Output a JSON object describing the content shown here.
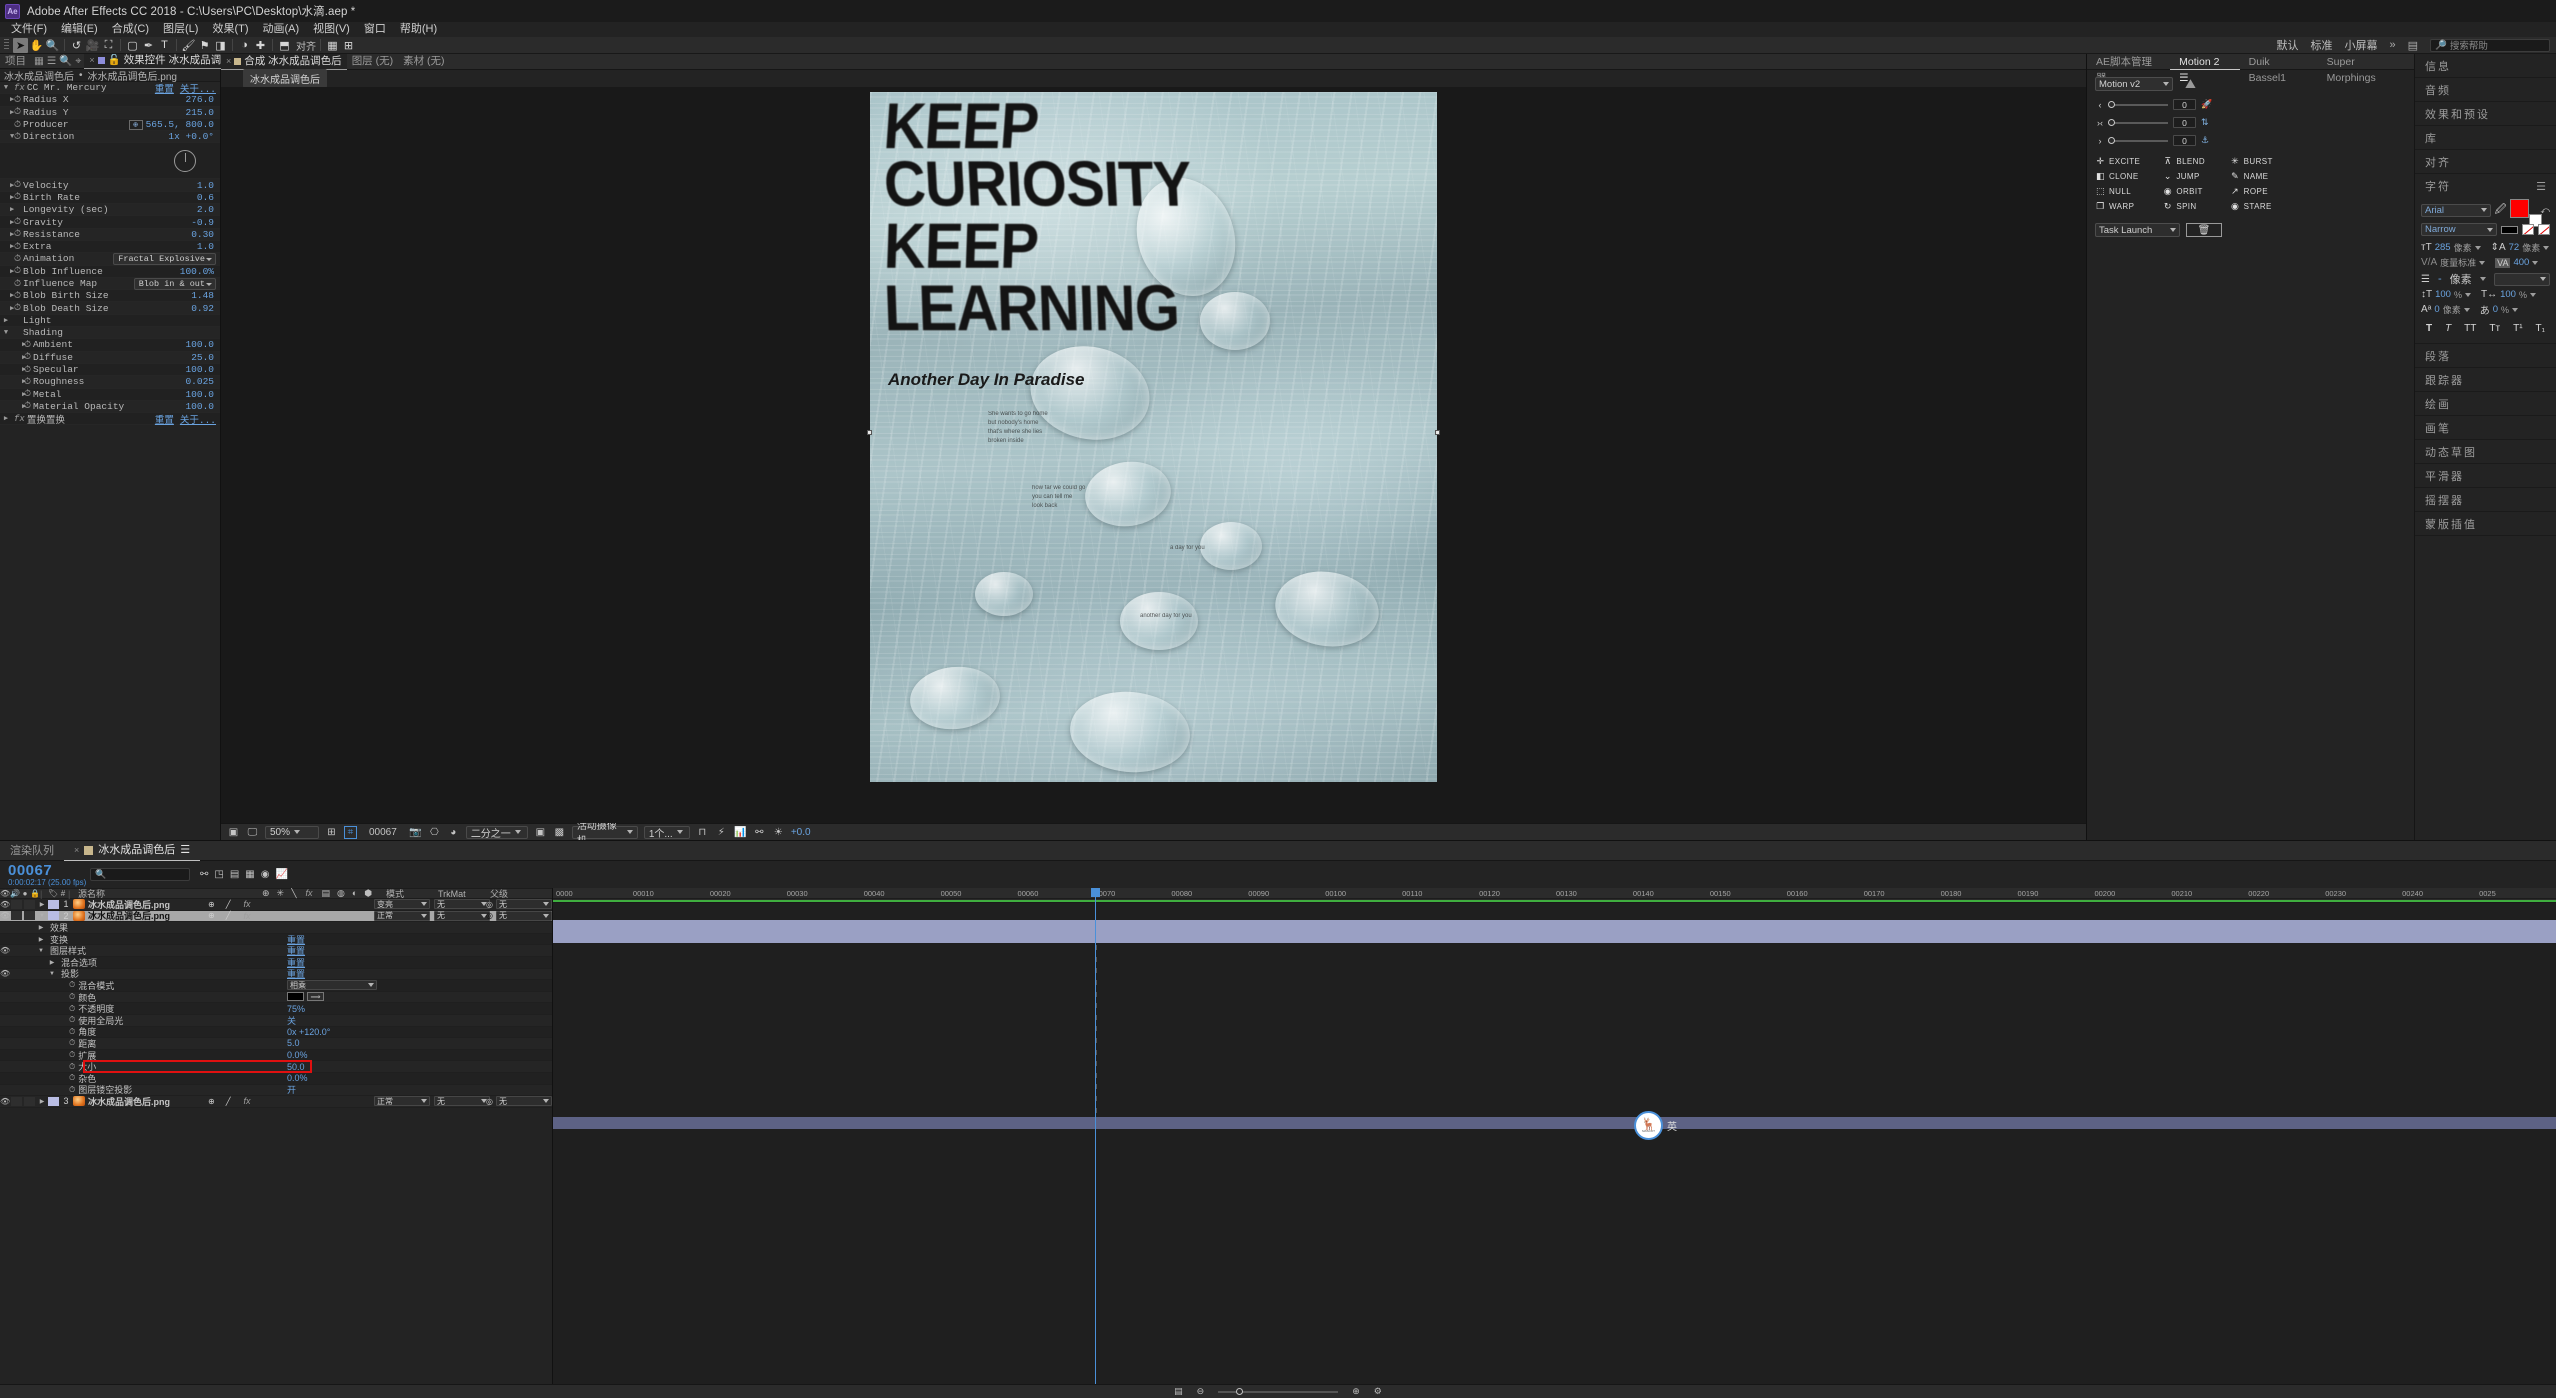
{
  "titlebar": {
    "logo": "Ae",
    "title": "Adobe After Effects CC 2018 - C:\\Users\\PC\\Desktop\\水滴.aep *"
  },
  "menubar": {
    "items": [
      "文件(F)",
      "编辑(E)",
      "合成(C)",
      "图层(L)",
      "效果(T)",
      "动画(A)",
      "视图(V)",
      "窗口",
      "帮助(H)"
    ]
  },
  "toolbar": {
    "icons": [
      "selection-tool",
      "hand-tool",
      "zoom-tool",
      "rotation-tool",
      "camera-tool",
      "anchor-point-tool",
      "mask-tool",
      "pen-tool",
      "text-tool",
      "brush-tool",
      "clone-stamp-tool",
      "eraser-tool",
      "roto-brush-tool",
      "puppet-tool"
    ],
    "workspace_left": "对齐",
    "workspaces": [
      "默认",
      "标准",
      "小屏幕"
    ],
    "search_placeholder": "搜索帮助"
  },
  "project_panel": {
    "tab_project": "项目",
    "tab_effect_controls": "效果控件 冰水成品调色后.png",
    "breadcrumb_comp": "冰水成品调色后",
    "breadcrumb_layer": "冰水成品调色后.png",
    "effect_name": "CC Mr. Mercury",
    "reset_label": "重置",
    "about_label": "关于...",
    "rows": [
      {
        "name": "Radius X",
        "value": "276.0",
        "indent": 1,
        "tw": "▶",
        "stop": true
      },
      {
        "name": "Radius Y",
        "value": "215.0",
        "indent": 1,
        "tw": "▶",
        "stop": true
      },
      {
        "name": "Producer",
        "value": "565.5, 800.0",
        "indent": 1,
        "tw": "",
        "stop": true,
        "point": true
      },
      {
        "name": "Direction",
        "value": "1x +0.0°",
        "indent": 1,
        "tw": "▼",
        "stop": true
      },
      {
        "name": "",
        "value": "",
        "indent": 1,
        "dial": true
      },
      {
        "name": "Velocity",
        "value": "1.0",
        "indent": 1,
        "tw": "▶",
        "stop": true
      },
      {
        "name": "Birth Rate",
        "value": "0.6",
        "indent": 1,
        "tw": "▶",
        "stop": true
      },
      {
        "name": "Longevity (sec)",
        "value": "2.0",
        "indent": 1,
        "tw": "▶",
        "stop": false
      },
      {
        "name": "Gravity",
        "value": "-0.9",
        "indent": 1,
        "tw": "▶",
        "stop": true
      },
      {
        "name": "Resistance",
        "value": "0.30",
        "indent": 1,
        "tw": "▶",
        "stop": true
      },
      {
        "name": "Extra",
        "value": "1.0",
        "indent": 1,
        "tw": "▶",
        "stop": true
      },
      {
        "name": "Animation",
        "value": "Fractal Explosive",
        "indent": 1,
        "tw": "",
        "stop": true,
        "select": true
      },
      {
        "name": "Blob Influence",
        "value": "100.0%",
        "indent": 1,
        "tw": "▶",
        "stop": true
      },
      {
        "name": "Influence Map",
        "value": "Blob in & out",
        "indent": 1,
        "tw": "",
        "stop": true,
        "select": true
      },
      {
        "name": "Blob Birth Size",
        "value": "1.48",
        "indent": 1,
        "tw": "▶",
        "stop": true
      },
      {
        "name": "Blob Death Size",
        "value": "0.92",
        "indent": 1,
        "tw": "▶",
        "stop": true
      },
      {
        "name": "Light",
        "value": "",
        "indent": 0,
        "tw": "▶",
        "stop": false
      },
      {
        "name": "Shading",
        "value": "",
        "indent": 0,
        "tw": "▼",
        "stop": false
      },
      {
        "name": "Ambient",
        "value": "100.0",
        "indent": 2,
        "tw": "▶",
        "stop": true
      },
      {
        "name": "Diffuse",
        "value": "25.0",
        "indent": 2,
        "tw": "▶",
        "stop": true
      },
      {
        "name": "Specular",
        "value": "100.0",
        "indent": 2,
        "tw": "▶",
        "stop": true
      },
      {
        "name": "Roughness",
        "value": "0.025",
        "indent": 2,
        "tw": "▶",
        "stop": true
      },
      {
        "name": "Metal",
        "value": "100.0",
        "indent": 2,
        "tw": "▶",
        "stop": true
      },
      {
        "name": "Material Opacity",
        "value": "100.0",
        "indent": 2,
        "tw": "▶",
        "stop": true
      }
    ],
    "second_effect": {
      "name": "置换置换",
      "reset": "重置",
      "about": "关于..."
    }
  },
  "viewer": {
    "tabs": [
      {
        "label": "合成 冰水成品调色后",
        "active": true
      },
      {
        "label": "图层 (无)",
        "active": false
      },
      {
        "label": "素材 (无)",
        "active": false
      }
    ],
    "comp_chip": "冰水成品调色后",
    "poster": {
      "lines": [
        "KEEP",
        "CURIOSITY",
        "KEEP",
        "LEARNING"
      ],
      "subtitle": "Another Day In Paradise",
      "body_blocks": [
        "She wants to go home\nbut nobody's home\nthat's where she lies\nbroken inside",
        "how far we could go\nyou can tell me\nlook back",
        "a day for you",
        "another day for you"
      ]
    },
    "bottom_bar": {
      "zoom": "50%",
      "frame": "00067",
      "resolution": "二分之一",
      "camera": "活动摄像机",
      "views": "1个...",
      "exposure": "+0.0"
    }
  },
  "script_panel": {
    "tabs": [
      "AE脚本管理器",
      "Motion 2",
      "Duik Bassel1",
      "Super Morphings"
    ],
    "active_tab": "Motion 2",
    "version_select": "Motion v2",
    "sliders": [
      {
        "icon": "‹",
        "value": "0"
      },
      {
        "icon": "›‹",
        "value": "0"
      },
      {
        "icon": "›",
        "value": "0"
      }
    ],
    "buttons": [
      {
        "label": "EXCITE",
        "icon": "✛"
      },
      {
        "label": "BLEND",
        "icon": "⊼"
      },
      {
        "label": "BURST",
        "icon": "✳"
      },
      {
        "label": "CLONE",
        "icon": "◧"
      },
      {
        "label": "JUMP",
        "icon": "⌄"
      },
      {
        "label": "NAME",
        "icon": "✎"
      },
      {
        "label": "NULL",
        "icon": "⬚"
      },
      {
        "label": "ORBIT",
        "icon": "◉"
      },
      {
        "label": "ROPE",
        "icon": "↗"
      },
      {
        "label": "WARP",
        "icon": "❐"
      },
      {
        "label": "SPIN",
        "icon": "↻"
      },
      {
        "label": "STARE",
        "icon": "◉"
      }
    ],
    "task_launch": "Task Launch",
    "trash_icon": "trash-icon"
  },
  "side_panels": {
    "items": [
      "信息",
      "音频",
      "效果和预设",
      "库",
      "对齐"
    ],
    "character": {
      "title": "字符",
      "font_family": "Arial",
      "font_style": "Narrow",
      "font_size": "285",
      "font_size_unit": "像素",
      "leading": "72",
      "leading_unit": "像素",
      "kerning": "度量标准",
      "tracking": "400",
      "stroke_width": "-",
      "stroke_width_unit": "像素",
      "vscale": "100",
      "hscale": "100",
      "baseline": "0",
      "baseline_unit": "像素",
      "tsume": "0",
      "styles": [
        "T",
        "T",
        "TT",
        "Tᴛ",
        "T¹",
        "T₁"
      ]
    },
    "more": [
      "段落",
      "跟踪器",
      "绘画",
      "画笔",
      "动态草图",
      "平滑器",
      "摇摆器",
      "蒙版插值"
    ]
  },
  "timeline": {
    "tabs": [
      {
        "label": "渲染队列",
        "active": false
      },
      {
        "label": "冰水成品调色后",
        "active": true
      }
    ],
    "current_frame": "00067",
    "current_time": "0:00:02:17 (25.00 fps)",
    "search_placeholder": "",
    "columns": [
      "源名称",
      "模式",
      "TrkMat",
      "父级"
    ],
    "col_toggles": [
      "👁",
      "🔊",
      "●",
      "🔒"
    ],
    "layers": [
      {
        "index": "1",
        "name": "冰水成品调色后.png",
        "mode": "变亮",
        "trkmat": "无",
        "parent": "无",
        "selected": false,
        "expanded": false
      },
      {
        "index": "2",
        "name": "冰水成品调色后.png",
        "mode": "正常",
        "trkmat": "无",
        "parent": "无",
        "selected": true,
        "expanded": true
      },
      {
        "index": "3",
        "name": "冰水成品调色后.png",
        "mode": "正常",
        "trkmat": "无",
        "parent": "无",
        "selected": false,
        "expanded": false
      }
    ],
    "properties": [
      {
        "name": "效果",
        "value": "",
        "indent": 1,
        "tw": "▶"
      },
      {
        "name": "变换",
        "value": "重置",
        "indent": 1,
        "tw": "▶",
        "link": true
      },
      {
        "name": "图层样式",
        "value": "重置",
        "indent": 1,
        "tw": "▼",
        "link": true,
        "eye": true
      },
      {
        "name": "混合选项",
        "value": "重置",
        "indent": 2,
        "tw": "▶",
        "link": true
      },
      {
        "name": "投影",
        "value": "重置",
        "indent": 2,
        "tw": "▼",
        "link": true,
        "eye": true
      },
      {
        "name": "混合模式",
        "value": "相乘",
        "indent": 3,
        "tw": "",
        "stop": true,
        "select": true
      },
      {
        "name": "颜色",
        "value": "",
        "indent": 3,
        "tw": "",
        "stop": true,
        "colorswatch": true
      },
      {
        "name": "不透明度",
        "value": "75%",
        "indent": 3,
        "tw": "",
        "stop": true
      },
      {
        "name": "使用全局光",
        "value": "关",
        "indent": 3,
        "tw": "",
        "stop": true
      },
      {
        "name": "角度",
        "value": "0x +120.0°",
        "indent": 3,
        "tw": "",
        "stop": true
      },
      {
        "name": "距离",
        "value": "5.0",
        "indent": 3,
        "tw": "",
        "stop": true
      },
      {
        "name": "扩展",
        "value": "0.0%",
        "indent": 3,
        "tw": "",
        "stop": true
      },
      {
        "name": "大小",
        "value": "50.0",
        "indent": 3,
        "tw": "",
        "stop": true,
        "highlight": true
      },
      {
        "name": "杂色",
        "value": "0.0%",
        "indent": 3,
        "tw": "",
        "stop": true
      },
      {
        "name": "图层镂空投影",
        "value": "开",
        "indent": 3,
        "tw": "",
        "stop": true
      }
    ],
    "ruler_ticks": [
      "0000",
      "00010",
      "00020",
      "00030",
      "00040",
      "00050",
      "00060",
      "00070",
      "00080",
      "00090",
      "00100",
      "00110",
      "00120",
      "00130",
      "00140",
      "00150",
      "00160",
      "00170",
      "00180",
      "00190",
      "00200",
      "00210",
      "00220",
      "00230",
      "00240",
      "0025"
    ],
    "mascot_label": "英"
  }
}
